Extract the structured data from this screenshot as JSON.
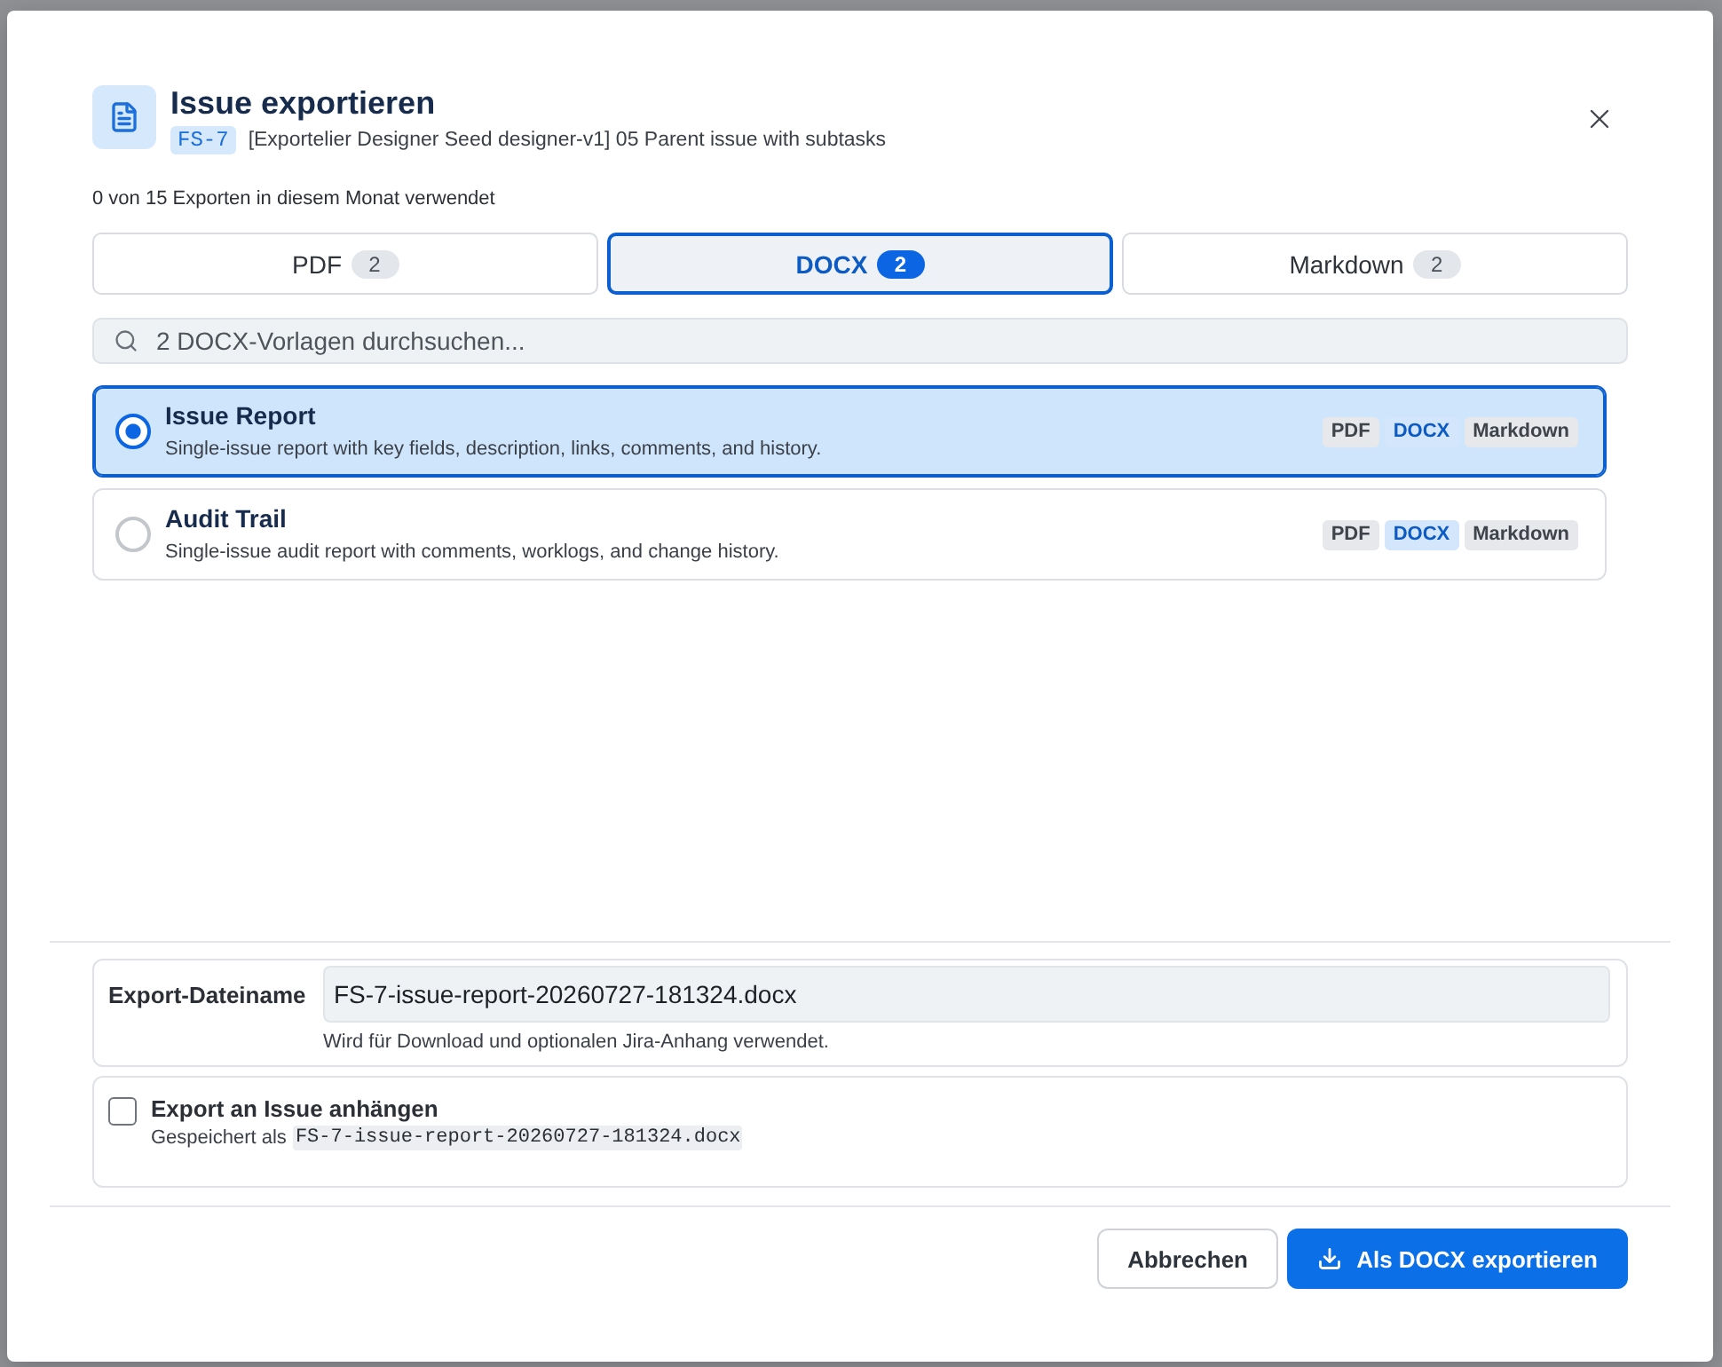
{
  "dialog": {
    "title": "Issue exportieren",
    "issue_key": "FS-7",
    "issue_summary": "[Exportelier Designer Seed designer-v1] 05 Parent issue with subtasks",
    "usage": "0 von 15 Exporten in diesem Monat verwendet"
  },
  "tabs": [
    {
      "label": "PDF",
      "count": "2",
      "selected": false
    },
    {
      "label": "DOCX",
      "count": "2",
      "selected": true
    },
    {
      "label": "Markdown",
      "count": "2",
      "selected": false
    }
  ],
  "search": {
    "placeholder": "2 DOCX-Vorlagen durchsuchen..."
  },
  "templates": [
    {
      "name": "Issue Report",
      "description": "Single-issue report with key fields, description, links, comments, and history.",
      "selected": true,
      "formats": [
        {
          "label": "PDF",
          "active": false
        },
        {
          "label": "DOCX",
          "active": true
        },
        {
          "label": "Markdown",
          "active": false
        }
      ]
    },
    {
      "name": "Audit Trail",
      "description": "Single-issue audit report with comments, worklogs, and change history.",
      "selected": false,
      "formats": [
        {
          "label": "PDF",
          "active": false
        },
        {
          "label": "DOCX",
          "active": true
        },
        {
          "label": "Markdown",
          "active": false
        }
      ]
    }
  ],
  "filename": {
    "label": "Export-Dateiname",
    "value": "FS-7-issue-report-20260727-181324.docx",
    "hint": "Wird für Download und optionalen Jira-Anhang verwendet."
  },
  "attach": {
    "label": "Export an Issue anhängen",
    "checked": false,
    "saved_as": "Gespeichert als",
    "saved_file": "FS-7-issue-report-20260727-181324.docx"
  },
  "buttons": {
    "cancel": "Abbrechen",
    "export": "Als DOCX exportieren"
  }
}
